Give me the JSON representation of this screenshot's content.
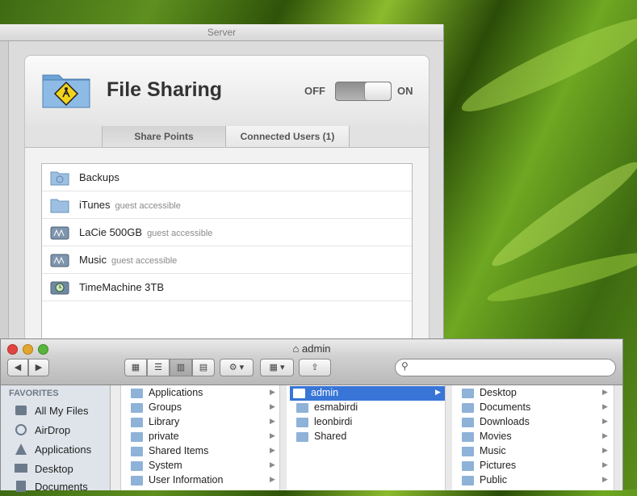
{
  "server_window": {
    "title": "Server",
    "panel_title": "File Sharing",
    "toggle": {
      "off_label": "OFF",
      "on_label": "ON",
      "state": "on"
    },
    "tabs": [
      {
        "label": "Share Points"
      },
      {
        "label": "Connected Users (1)"
      }
    ],
    "share_points": [
      {
        "name": "Backups",
        "note": "",
        "icon": "backup-folder-icon"
      },
      {
        "name": "iTunes",
        "note": "guest accessible",
        "icon": "folder-icon"
      },
      {
        "name": "LaCie 500GB",
        "note": "guest accessible",
        "icon": "drive-icon"
      },
      {
        "name": "Music",
        "note": "guest accessible",
        "icon": "drive-icon"
      },
      {
        "name": "TimeMachine 3TB",
        "note": "",
        "icon": "timemachine-drive-icon"
      }
    ]
  },
  "finder": {
    "title": "admin",
    "sidebar": {
      "heading": "FAVORITES",
      "items": [
        {
          "label": "All My Files"
        },
        {
          "label": "AirDrop"
        },
        {
          "label": "Applications"
        },
        {
          "label": "Desktop"
        },
        {
          "label": "Documents"
        }
      ]
    },
    "column1": [
      {
        "label": "Applications"
      },
      {
        "label": "Groups"
      },
      {
        "label": "Library"
      },
      {
        "label": "private"
      },
      {
        "label": "Shared Items"
      },
      {
        "label": "System"
      },
      {
        "label": "User Information"
      }
    ],
    "column2": [
      {
        "label": "admin",
        "selected": true
      },
      {
        "label": "esmabirdi"
      },
      {
        "label": "leonbirdi"
      },
      {
        "label": "Shared"
      }
    ],
    "column3": [
      {
        "label": "Desktop"
      },
      {
        "label": "Documents"
      },
      {
        "label": "Downloads"
      },
      {
        "label": "Movies"
      },
      {
        "label": "Music"
      },
      {
        "label": "Pictures"
      },
      {
        "label": "Public"
      }
    ]
  },
  "colors": {
    "selection": "#3875d7",
    "folder": "#8fb2d8"
  }
}
